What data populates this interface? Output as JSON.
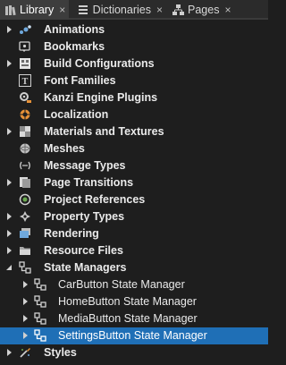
{
  "tabs": [
    {
      "label": "Library",
      "icon": "library-icon",
      "active": true,
      "close": "×"
    },
    {
      "label": "Dictionaries",
      "icon": "dictionaries-icon",
      "active": false,
      "close": "×"
    },
    {
      "label": "Pages",
      "icon": "pages-icon",
      "active": false,
      "close": "×"
    }
  ],
  "tree": [
    {
      "label": "Animations",
      "icon": "animation-icon",
      "expanded": false
    },
    {
      "label": "Bookmarks",
      "icon": "bookmark-icon",
      "expanded": null
    },
    {
      "label": "Build Configurations",
      "icon": "build-configuration-icon",
      "expanded": false
    },
    {
      "label": "Font Families",
      "icon": "font-icon",
      "expanded": null
    },
    {
      "label": "Kanzi Engine Plugins",
      "icon": "plugin-icon",
      "expanded": null
    },
    {
      "label": "Localization",
      "icon": "localization-icon",
      "expanded": null
    },
    {
      "label": "Materials and Textures",
      "icon": "material-icon",
      "expanded": false
    },
    {
      "label": "Meshes",
      "icon": "mesh-icon",
      "expanded": null
    },
    {
      "label": "Message Types",
      "icon": "message-icon",
      "expanded": null
    },
    {
      "label": "Page Transitions",
      "icon": "page-transition-icon",
      "expanded": false
    },
    {
      "label": "Project References",
      "icon": "project-reference-icon",
      "expanded": null
    },
    {
      "label": "Property Types",
      "icon": "property-type-icon",
      "expanded": false
    },
    {
      "label": "Rendering",
      "icon": "rendering-icon",
      "expanded": false
    },
    {
      "label": "Resource Files",
      "icon": "folder-icon",
      "expanded": false
    },
    {
      "label": "State Managers",
      "icon": "state-manager-icon",
      "expanded": true
    },
    {
      "label": "CarButton State Manager",
      "icon": "state-manager-icon",
      "child": true,
      "expanded": false
    },
    {
      "label": "HomeButton State Manager",
      "icon": "state-manager-icon",
      "child": true,
      "expanded": false
    },
    {
      "label": "MediaButton State Manager",
      "icon": "state-manager-icon",
      "child": true,
      "expanded": false
    },
    {
      "label": "SettingsButton State Manager",
      "icon": "state-manager-icon",
      "child": true,
      "expanded": false,
      "selected": true
    },
    {
      "label": "Styles",
      "icon": "style-icon",
      "expanded": false
    }
  ],
  "colors": {
    "background": "#1e1e1e",
    "selection": "#1f6fb6",
    "tab_active": "#3d3d3d",
    "tab_bar": "#2b2b2b"
  }
}
